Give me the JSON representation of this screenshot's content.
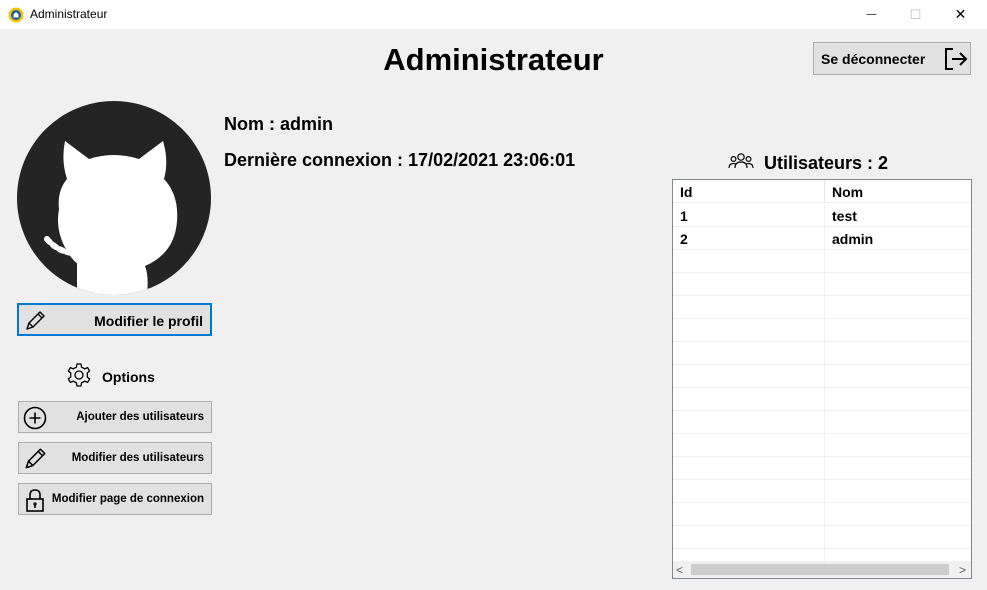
{
  "window": {
    "title": "Administrateur",
    "minimize_symbol": "—",
    "maximize_symbol": "☐",
    "close_symbol": "✕"
  },
  "header": {
    "title": "Administrateur",
    "logout_label": "Se déconnecter"
  },
  "profile": {
    "name_line": "Nom : admin",
    "last_login_line": "Dernière connexion : 17/02/2021 23:06:01",
    "edit_profile_label": "Modifier le profil"
  },
  "options": {
    "heading": "Options",
    "buttons": [
      {
        "label": "Ajouter des utilisateurs",
        "icon": "plus-circle-icon"
      },
      {
        "label": "Modifier des utilisateurs",
        "icon": "pencil-icon"
      },
      {
        "label": "Modifier page de connexion",
        "icon": "lock-icon"
      }
    ]
  },
  "users": {
    "heading": "Utilisateurs : 2",
    "columns": [
      "Id",
      "Nom"
    ],
    "rows": [
      [
        "1",
        "test"
      ],
      [
        "2",
        "admin"
      ]
    ],
    "scroll_left": "<",
    "scroll_right": ">"
  },
  "colors": {
    "window_bg": "#f0f0f0",
    "button_bg": "#e1e1e1",
    "focus_border": "#0078d7",
    "avatar_bg": "#242424"
  }
}
